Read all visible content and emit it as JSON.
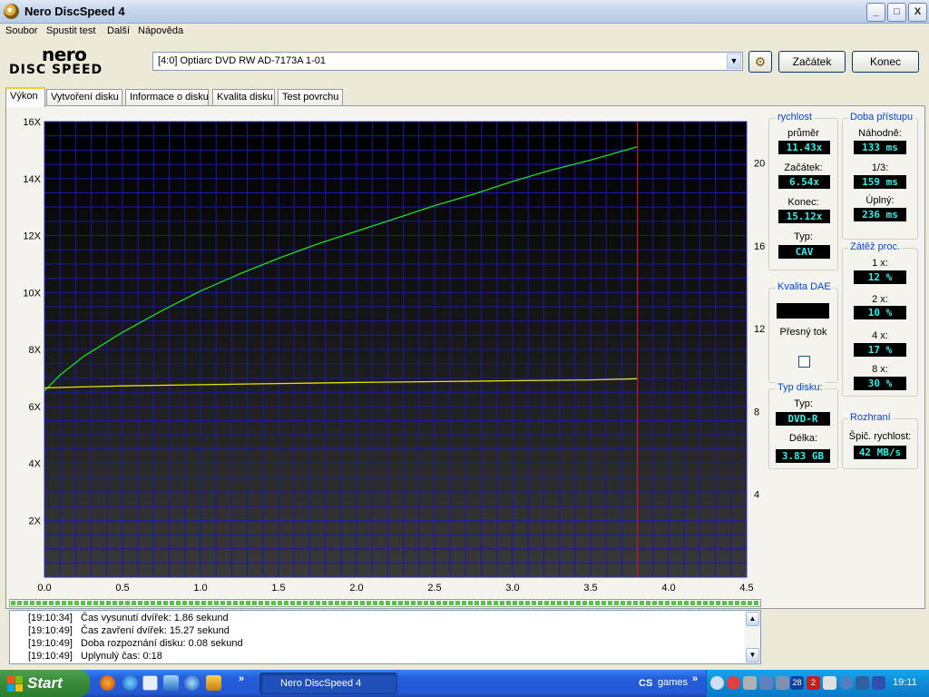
{
  "window": {
    "title": "Nero DiscSpeed 4",
    "controls": {
      "minimize": "_",
      "maximize": "□",
      "close": "X"
    }
  },
  "menu": [
    "Soubor",
    "Spustit test",
    "Další",
    "Nápověda"
  ],
  "logo": {
    "line1": "nero",
    "line2": "DISC SPEED"
  },
  "toolbar": {
    "drive": "[4:0]  Optiarc DVD RW AD-7173A 1-01",
    "start_label": "Začátek",
    "end_label": "Konec"
  },
  "tabs": [
    "Výkon",
    "Vytvoření disku",
    "Informace o disku",
    "Kvalita disku",
    "Test povrchu"
  ],
  "chart_data": {
    "type": "line",
    "title": "",
    "xlabel": "",
    "ylabel": "",
    "xlim": [
      0,
      4.5
    ],
    "ylim": [
      0,
      16
    ],
    "y2lim": [
      0,
      22
    ],
    "x_ticks": [
      "0.0",
      "0.5",
      "1.0",
      "1.5",
      "2.0",
      "2.5",
      "3.0",
      "3.5",
      "4.0",
      "4.5"
    ],
    "y_ticks": [
      "2X",
      "4X",
      "6X",
      "8X",
      "10X",
      "12X",
      "14X",
      "16X"
    ],
    "y2_ticks": [
      "4",
      "8",
      "12",
      "16",
      "20"
    ],
    "grid": true,
    "cursor_x": 3.8,
    "colors": {
      "background": "#000000",
      "grid": "#1a1aa8",
      "read_speed": "#22dd22",
      "rotation": "#e6e600",
      "cursor": "#d02020"
    },
    "series": [
      {
        "color": "#22dd22",
        "x": [
          0.0,
          0.1,
          0.25,
          0.5,
          0.75,
          1.0,
          1.25,
          1.5,
          1.75,
          2.0,
          2.25,
          2.5,
          2.75,
          3.0,
          3.25,
          3.5,
          3.8
        ],
        "values": [
          6.54,
          7.1,
          7.75,
          8.6,
          9.35,
          10.05,
          10.65,
          11.2,
          11.7,
          12.15,
          12.6,
          13.05,
          13.45,
          13.9,
          14.3,
          14.65,
          15.12
        ]
      },
      {
        "color": "#e6e600",
        "x": [
          0.0,
          0.5,
          1.0,
          1.5,
          2.0,
          2.5,
          3.0,
          3.5,
          3.8
        ],
        "values": [
          6.65,
          6.72,
          6.76,
          6.8,
          6.84,
          6.87,
          6.9,
          6.93,
          6.97
        ]
      }
    ]
  },
  "speed": {
    "title": "rychlost",
    "avg_label": "průměr",
    "avg": "11.43x",
    "start_label": "Začátek:",
    "start": "6.54x",
    "end_label": "Konec:",
    "end": "15.12x",
    "type_label": "Typ:",
    "type": "CAV"
  },
  "access": {
    "title": "Doba přístupu",
    "random_label": "Náhodně:",
    "random": "133 ms",
    "third_label": "1/3:",
    "third": "159 ms",
    "full_label": "Úplný:",
    "full": "236 ms"
  },
  "dae": {
    "title": "Kvalita DAE",
    "value": "",
    "accurate_label": "Přesný tok"
  },
  "cpu": {
    "title": "Zátěž proc.",
    "x1_label": "1 x:",
    "x1": "12 %",
    "x2_label": "2 x:",
    "x2": "10 %",
    "x4_label": "4 x:",
    "x4": "17 %",
    "x8_label": "8 x:",
    "x8": "30 %"
  },
  "disc": {
    "title": "Typ disku:",
    "type_label": "Typ:",
    "type": "DVD-R",
    "length_label": "Délka:",
    "length": "3.83 GB"
  },
  "interface": {
    "title": "Rozhraní",
    "peak_label": "Špič. rychlost:",
    "peak": "42 MB/s"
  },
  "progress": 1.0,
  "log": [
    {
      "time": "[19:10:34]",
      "text": "Čas vysunutí dvířek: 1.86 sekund"
    },
    {
      "time": "[19:10:49]",
      "text": "Čas zavření dvířek: 15.27 sekund"
    },
    {
      "time": "[19:10:49]",
      "text": "Doba rozpoznání disku: 0.08 sekund"
    },
    {
      "time": "[19:10:49]",
      "text": "Uplynulý čas:  0:18"
    }
  ],
  "taskbar": {
    "start": "Start",
    "task": "Nero DiscSpeed 4",
    "lang": "CS",
    "toolbar": "games",
    "more": "»",
    "clock": "19:11",
    "tray_28": "28",
    "tray_2": "2"
  }
}
